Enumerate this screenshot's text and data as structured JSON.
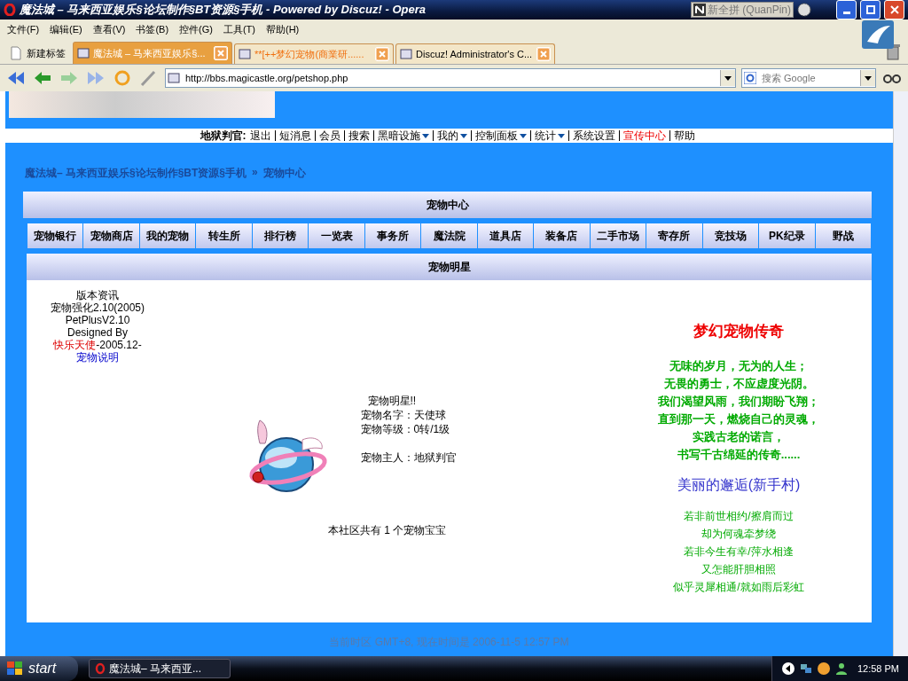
{
  "window": {
    "title": "魔法城 – 马来西亚娱乐§论坛制作§BT资源§手机 - Powered by Discuz! - Opera",
    "ime": "新全拼 (QuanPin)"
  },
  "menu": [
    "文件(F)",
    "编辑(E)",
    "查看(V)",
    "书签(B)",
    "控件(G)",
    "工具(T)",
    "帮助(H)"
  ],
  "new_tab": "新建标签",
  "tabs": [
    {
      "label": "魔法城 – 马来西亚娱乐§...",
      "selected": true,
      "highlighted": false
    },
    {
      "label": "**[++梦幻宠物(商業研......",
      "selected": false,
      "highlighted": true
    },
    {
      "label": "Discuz! Administrator's C...",
      "selected": false,
      "highlighted": false
    }
  ],
  "address": {
    "value": "http://bbs.magicastle.org/petshop.php"
  },
  "search": {
    "placeholder": "搜索 Google"
  },
  "nav": {
    "user": "地狱判官:",
    "links": [
      {
        "label": "退出",
        "dropdown": false,
        "highlighted": false
      },
      {
        "label": "短消息",
        "dropdown": false,
        "highlighted": false
      },
      {
        "label": "会员",
        "dropdown": false,
        "highlighted": false
      },
      {
        "label": "搜索",
        "dropdown": false,
        "highlighted": false
      },
      {
        "label": "黑暗设施",
        "dropdown": true,
        "highlighted": false
      },
      {
        "label": "我的",
        "dropdown": true,
        "highlighted": false
      },
      {
        "label": "控制面板",
        "dropdown": true,
        "highlighted": false
      },
      {
        "label": "统计",
        "dropdown": true,
        "highlighted": false
      },
      {
        "label": "系统设置",
        "dropdown": false,
        "highlighted": false
      },
      {
        "label": "宣传中心",
        "dropdown": false,
        "highlighted": true
      },
      {
        "label": "帮助",
        "dropdown": false,
        "highlighted": false
      }
    ]
  },
  "breadcrumb": [
    "魔法城– 马来西亚娱乐§论坛制作§BT资源§手机",
    "»",
    "宠物中心"
  ],
  "panel_title": "宠物中心",
  "pet_nav": [
    "宠物银行",
    "宠物商店",
    "我的宠物",
    "转生所",
    "排行榜",
    "一览表",
    "事务所",
    "魔法院",
    "道具店",
    "装备店",
    "二手市场",
    "寄存所",
    "竞技场",
    "PK纪录",
    "野战"
  ],
  "section_title": "宠物明星",
  "version": {
    "lines": [
      "版本资讯",
      "宠物强化2.10(2005)",
      "PetPlusV2.10",
      "Designed By"
    ],
    "author": "快乐天使",
    "date": "-2005.12-",
    "help_link": "宠物说明"
  },
  "pet": {
    "heading": "宠物明星!!",
    "name": "宠物名字：天使球",
    "level": "宠物等级：0转/1级",
    "owner": "宠物主人：地狱判官",
    "count": "本社区共有 1 个宠物宝宝"
  },
  "legend": {
    "title": "梦幻宠物传奇",
    "poem": [
      "无味的岁月，无为的人生；",
      "无畏的勇士，不应虚度光阴。",
      "我们渴望风雨，我们期盼飞翔；",
      "直到那一天，燃烧自己的灵魂，",
      "实践古老的诺言，",
      "书写千古绵延的传奇......"
    ],
    "subtitle": "美丽的邂逅(新手村)",
    "verses": [
      "若非前世相约/擦肩而过",
      "却为何魂牵梦绕",
      "若非今生有幸/萍水相逢",
      "又怎能肝胆相照",
      "似乎灵犀相通/就如雨后彩虹"
    ]
  },
  "footer": "当前时区 GMT+8, 现在时间是 2006-11-5 12:57 PM",
  "taskbar": {
    "start": "start",
    "task": "魔法城– 马来西亚...",
    "clock": "12:58 PM"
  }
}
